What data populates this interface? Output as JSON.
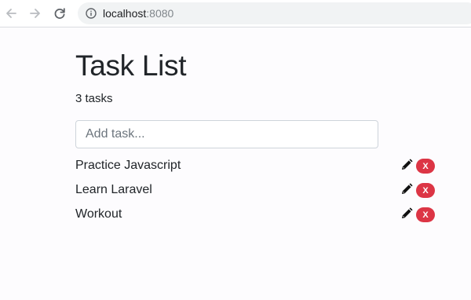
{
  "browser": {
    "url_host": "localhost",
    "url_port": ":8080",
    "icons": [
      "back-arrow-icon",
      "forward-arrow-icon",
      "reload-icon",
      "info-icon"
    ]
  },
  "page": {
    "title": "Task List",
    "task_count": "3 tasks",
    "input": {
      "value": "",
      "placeholder": "Add task..."
    },
    "tasks": [
      {
        "label": "Practice Javascript",
        "delete_label": "X"
      },
      {
        "label": "Learn Laravel",
        "delete_label": "X"
      },
      {
        "label": "Workout",
        "delete_label": "X"
      }
    ]
  },
  "colors": {
    "danger": "#dc3545",
    "text": "#212529",
    "input_border": "#ced4da"
  }
}
